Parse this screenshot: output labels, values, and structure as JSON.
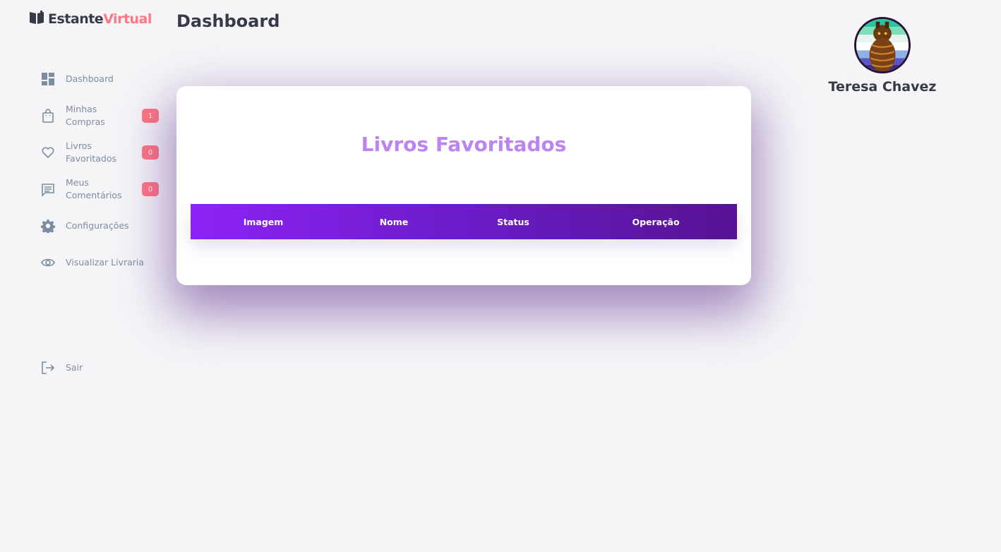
{
  "brand": {
    "part1": "Estante",
    "part2": "Virtual"
  },
  "header": {
    "title": "Dashboard"
  },
  "sidebar": {
    "items": [
      {
        "label": "Dashboard",
        "icon": "dashboard-icon"
      },
      {
        "label": "Minhas Compras",
        "icon": "shopping-bag-icon",
        "badge": "1"
      },
      {
        "label": "Livros Favoritados",
        "icon": "heart-icon",
        "badge": "0"
      },
      {
        "label": "Meus Comentários",
        "icon": "comment-icon",
        "badge": "0"
      },
      {
        "label": "Configurações",
        "icon": "gear-icon"
      },
      {
        "label": "Visualizar Livraria",
        "icon": "eye-icon"
      }
    ],
    "logout": {
      "label": "Sair",
      "icon": "logout-icon"
    }
  },
  "card": {
    "title": "Livros Favoritados",
    "columns": [
      "Imagem",
      "Nome",
      "Status",
      "Operação"
    ]
  },
  "profile": {
    "name": "Teresa Chavez"
  },
  "colors": {
    "accent": "#ff7782",
    "title_purple": "#bb84f0",
    "header_gradient_start": "#8e22f5",
    "header_gradient_end": "#561393",
    "text_dark": "#363949",
    "text_muted": "#7d8da1"
  }
}
